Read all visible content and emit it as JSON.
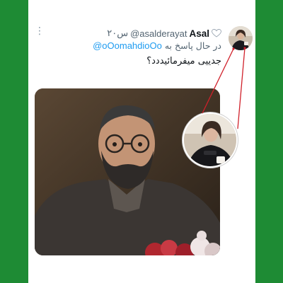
{
  "tweet": {
    "display_name": "Asal",
    "handle": "@asalderayat",
    "time": "۲۰س",
    "replying_prefix": "در حال پاسخ به",
    "replying_to": "@oOomahdioOo",
    "text": "جدییی میفرمائیددد؟",
    "more_icon": "more-options-icon",
    "badge_icon": "white-heart-icon"
  },
  "colors": {
    "frame": "#1e8b34",
    "card": "#ffffff",
    "mention": "#1d9bf0",
    "secondary_text": "#536471",
    "annotation": "#d0202a"
  }
}
